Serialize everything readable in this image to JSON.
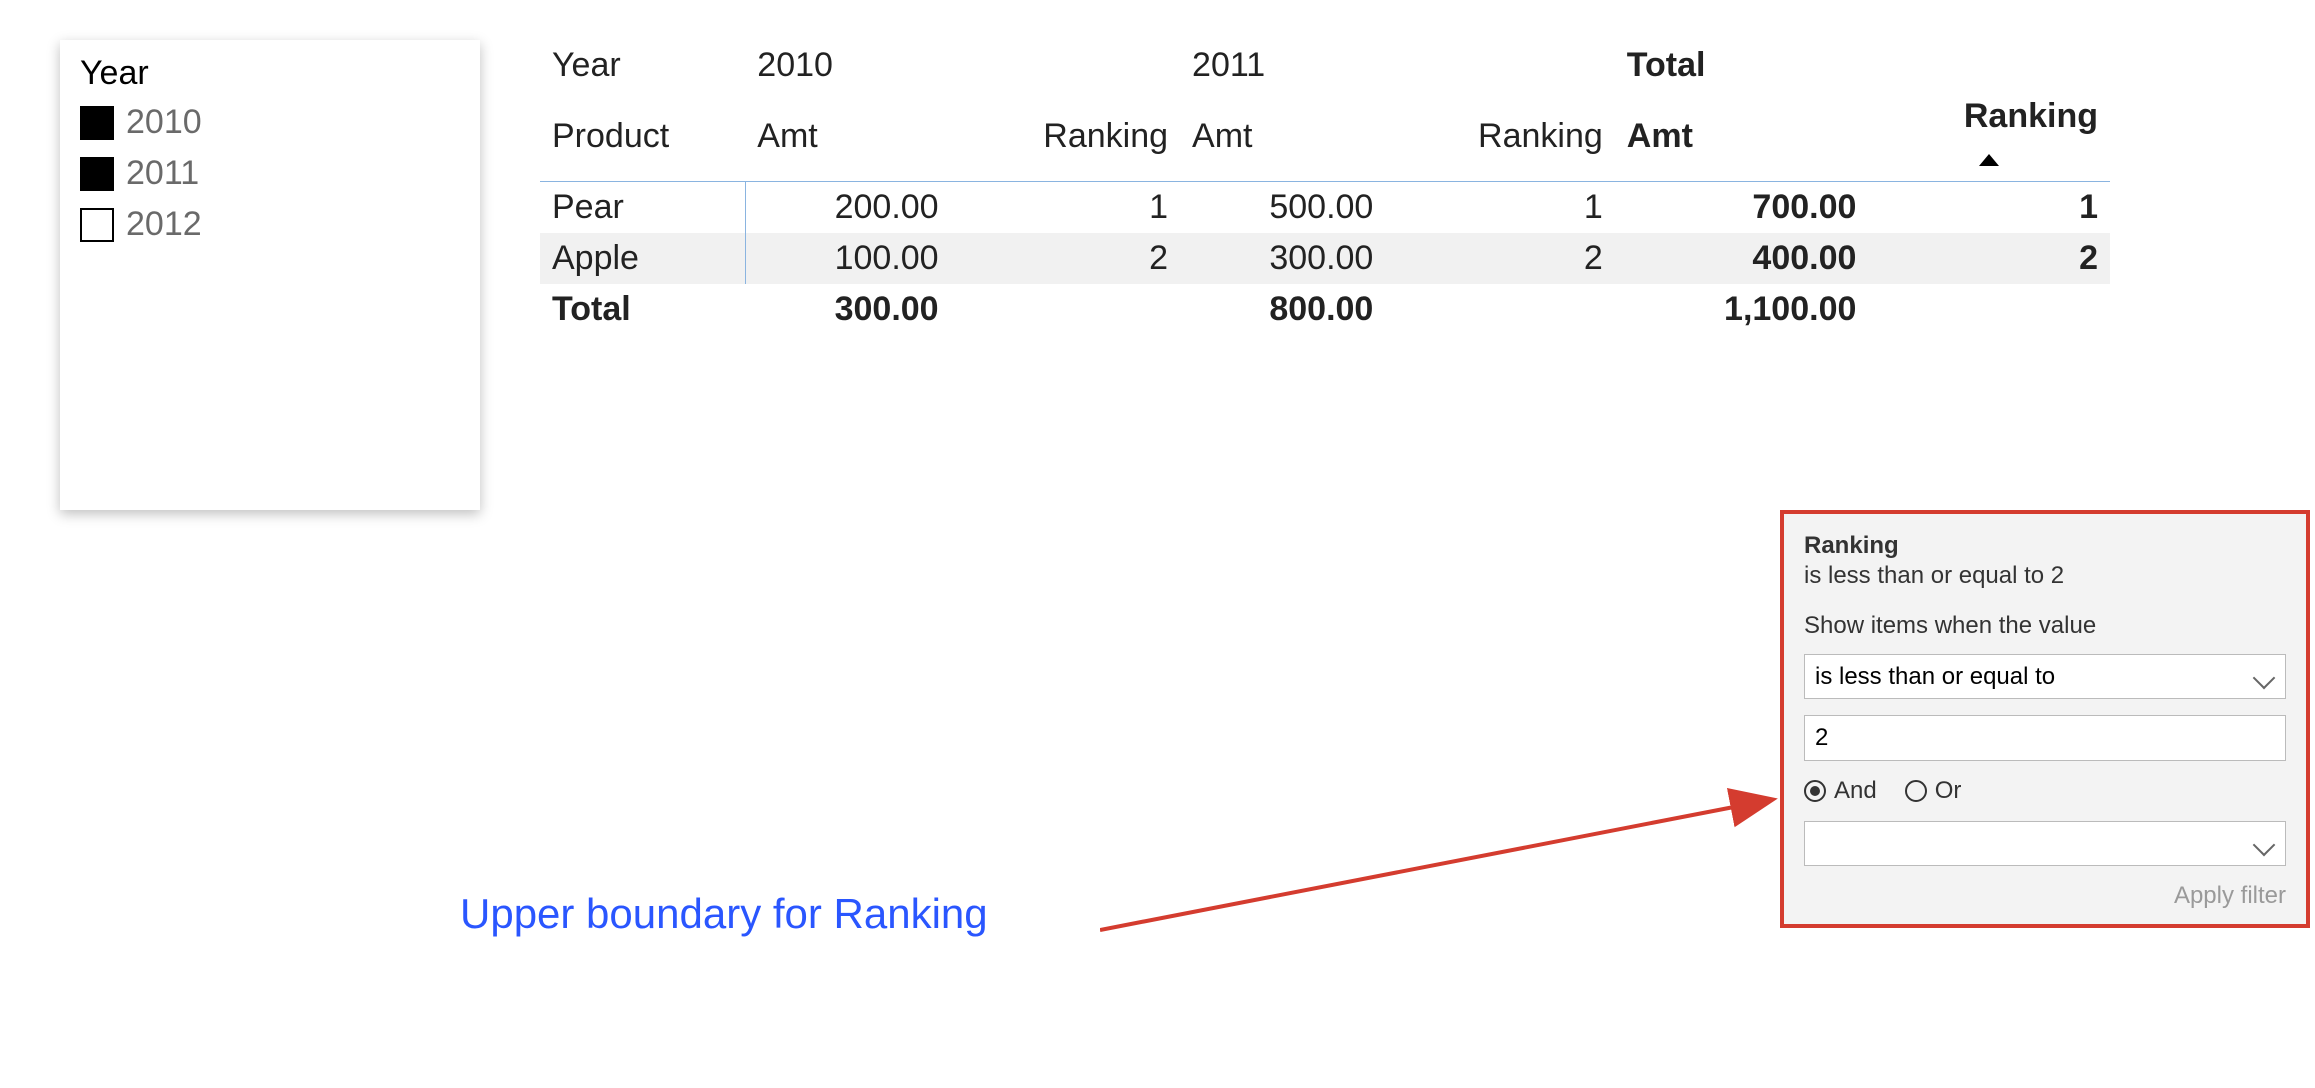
{
  "slicer": {
    "title": "Year",
    "items": [
      {
        "label": "2010",
        "checked": true
      },
      {
        "label": "2011",
        "checked": true
      },
      {
        "label": "2012",
        "checked": false
      }
    ]
  },
  "matrix": {
    "corner": {
      "year": "Year",
      "product": "Product"
    },
    "year_groups": [
      "2010",
      "2011"
    ],
    "total_label": "Total",
    "measures": {
      "amt": "Amt",
      "ranking": "Ranking"
    },
    "sort_on_total_ranking": "asc",
    "rows": [
      {
        "product": "Pear",
        "y2010_amt": "200.00",
        "y2010_rank": "1",
        "y2011_amt": "500.00",
        "y2011_rank": "1",
        "total_amt": "700.00",
        "total_rank": "1"
      },
      {
        "product": "Apple",
        "y2010_amt": "100.00",
        "y2010_rank": "2",
        "y2011_amt": "300.00",
        "y2011_rank": "2",
        "total_amt": "400.00",
        "total_rank": "2"
      }
    ],
    "grand_total": {
      "label": "Total",
      "y2010_amt": "300.00",
      "y2011_amt": "800.00",
      "total_amt": "1,100.00"
    }
  },
  "filter_card": {
    "title": "Ranking",
    "summary": "is less than or equal to 2",
    "prompt": "Show items when the value",
    "condition1": "is less than or equal to",
    "value1": "2",
    "logic": {
      "and": "And",
      "or": "Or",
      "selected": "and"
    },
    "condition2": "",
    "apply_label": "Apply filter"
  },
  "annotation": {
    "label": "Upper boundary for Ranking"
  }
}
